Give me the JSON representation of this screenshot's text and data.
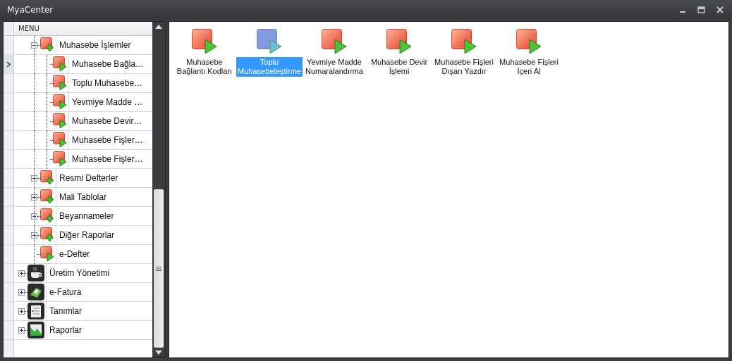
{
  "window": {
    "title": "MyaCenter"
  },
  "tree": {
    "header": "MENU",
    "items": [
      {
        "children": [
          {
            "label": "Muhasebe İşlemler",
            "kind": "folder",
            "expanded": true,
            "current": false,
            "children": [
              {
                "label": "Muhasebe Bağla…",
                "kind": "action",
                "current": true
              },
              {
                "label": "Toplu Muhasebe…",
                "kind": "action",
                "current": false
              },
              {
                "label": "Yevmiye Madde …",
                "kind": "action",
                "current": false
              },
              {
                "label": "Muhasebe Devir…",
                "kind": "action",
                "current": false
              },
              {
                "label": "Muhasebe Fişler…",
                "kind": "action",
                "current": false
              },
              {
                "label": "Muhasebe Fişler…",
                "kind": "action",
                "current": false
              }
            ]
          },
          {
            "label": "Resmi Defterler",
            "kind": "folder",
            "expanded": false,
            "current": false
          },
          {
            "label": "Mali Tablolar",
            "kind": "folder",
            "expanded": false,
            "current": false
          },
          {
            "label": "Beyannameler",
            "kind": "folder",
            "expanded": false,
            "current": false
          },
          {
            "label": "Diğer Raporlar",
            "kind": "folder",
            "expanded": false,
            "current": false
          },
          {
            "label": "e-Defter",
            "kind": "action",
            "current": false
          }
        ]
      },
      {
        "label": "Üretim Yönetimi",
        "kind": "production",
        "expanded": false,
        "current": false
      },
      {
        "label": "e-Fatura",
        "kind": "invoice",
        "expanded": false,
        "current": false
      },
      {
        "label": "Tanımlar",
        "kind": "definitions",
        "expanded": false,
        "current": false
      },
      {
        "label": "Raporlar",
        "kind": "reports",
        "expanded": false,
        "current": false
      }
    ]
  },
  "tiles": [
    {
      "label": "Muhasebe\nBağlantı Kodları",
      "selected": false
    },
    {
      "label": "Toplu\nMuhasebeleştirme",
      "selected": true
    },
    {
      "label": "Yevmiye Madde\nNumaralandırma",
      "selected": false
    },
    {
      "label": "Muhasebe Devir\nİşlemi",
      "selected": false
    },
    {
      "label": "Muhasebe Fişleri\nDışarı Yazdır",
      "selected": false
    },
    {
      "label": "Muhasebe Fişleri\nİçeri Al",
      "selected": false
    }
  ]
}
